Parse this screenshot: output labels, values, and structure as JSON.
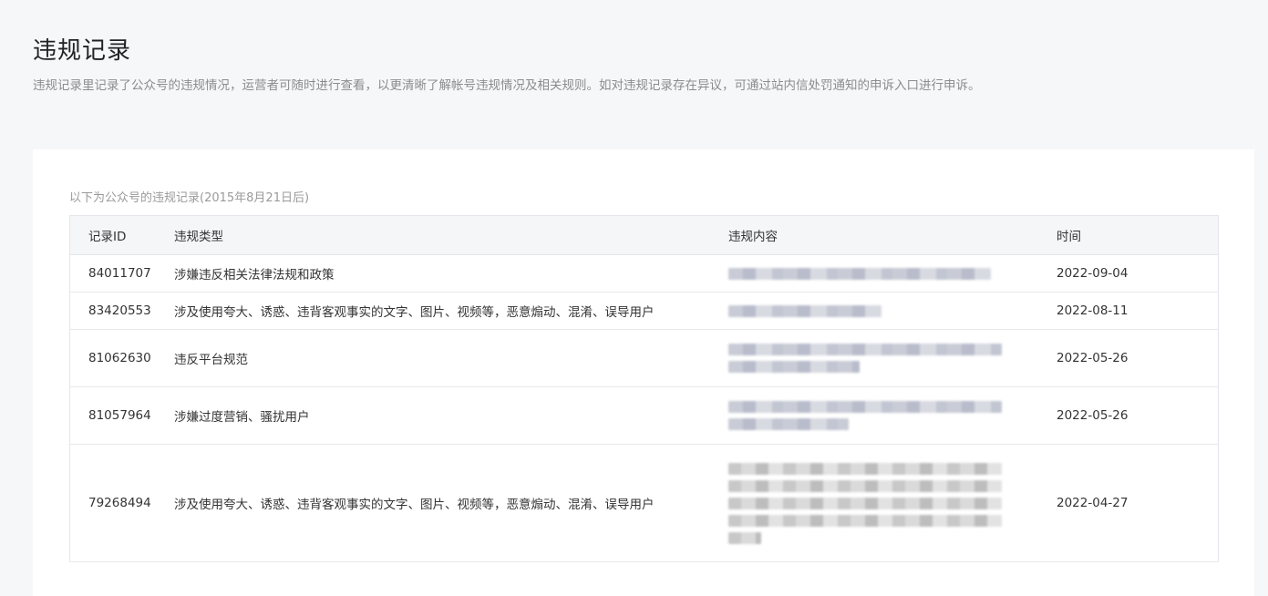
{
  "page": {
    "title": "违规记录",
    "description": "违规记录里记录了公众号的违规情况，运营者可随时进行查看，以更清晰了解帐号违规情况及相关规则。如对违规记录存在异议，可通过站内信处罚通知的申诉入口进行申诉。"
  },
  "card": {
    "subtitle": "以下为公众号的违规记录(2015年8月21日后)"
  },
  "table": {
    "headers": {
      "id": "记录ID",
      "type": "违规类型",
      "content": "违规内容",
      "time": "时间"
    },
    "rows": [
      {
        "id": "84011707",
        "type": "涉嫌违反相关法律法规和政策",
        "time": "2022-09-04"
      },
      {
        "id": "83420553",
        "type": "涉及使用夸大、诱惑、违背客观事实的文字、图片、视频等，恶意煽动、混淆、误导用户",
        "time": "2022-08-11"
      },
      {
        "id": "81062630",
        "type": "违反平台规范",
        "time": "2022-05-26"
      },
      {
        "id": "81057964",
        "type": "涉嫌过度营销、骚扰用户",
        "time": "2022-05-26"
      },
      {
        "id": "79268494",
        "type": "涉及使用夸大、诱惑、违背客观事实的文字、图片、视频等，恶意煽动、混淆、误导用户",
        "time": "2022-04-27"
      }
    ]
  }
}
